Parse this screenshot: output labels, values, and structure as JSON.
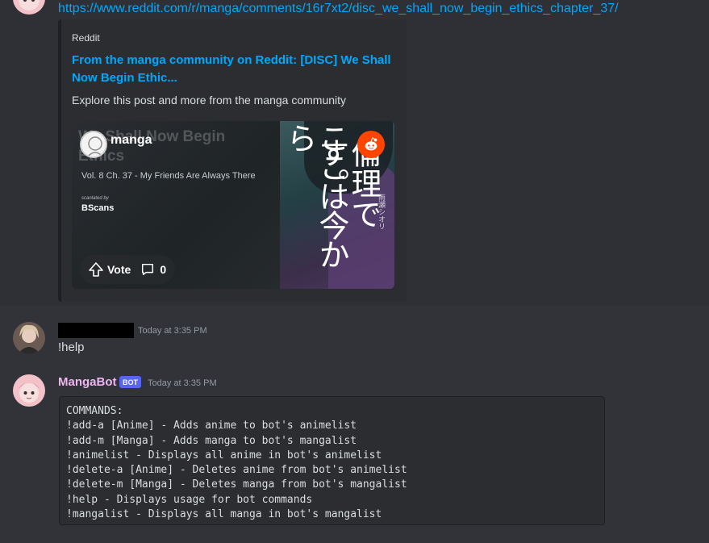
{
  "link_message": {
    "url": "https://www.reddit.com/r/manga/comments/16r7xt2/disc_we_shall_now_begin_ethics_chapter_37/"
  },
  "embed": {
    "provider": "Reddit",
    "title": "From the manga community on Reddit: [DISC] We Shall Now Begin Ethic...",
    "description": "Explore this post and more from the manga community",
    "image": {
      "background_title": "We Shall Now Begin Ethics",
      "subreddit": "manga",
      "chapter_info": "Vol. 8 Ch. 37 - My Friends Are Always There",
      "scanlated_by_label": "scanlated by",
      "scanlator": "BScans",
      "cover_text_1": "ここは今から",
      "cover_text_2": "倫理です。",
      "cover_author": "雨瀬シオリ",
      "vote_label": "Vote",
      "comment_count": "0",
      "reddit_icon": "reddit-icon"
    }
  },
  "user_message": {
    "timestamp": "Today at 3:35 PM",
    "text": "!help"
  },
  "bot_message": {
    "name": "MangaBot",
    "badge": "BOT",
    "timestamp": "Today at 3:35 PM",
    "code_lines": [
      "COMMANDS:",
      "!add-a [Anime] - Adds anime to bot's animelist",
      "!add-m [Manga] - Adds manga to bot's mangalist",
      "!animelist - Displays all anime in bot's animelist",
      "!delete-a [Anime] - Deletes anime from bot's animelist",
      "!delete-m [Manga] - Deletes manga from bot's mangalist",
      "!help - Displays usage for bot commands",
      "!mangalist - Displays all manga in bot's mangalist"
    ]
  },
  "colors": {
    "background": "#313338",
    "hover_background": "#2e3035",
    "link": "#00a8fc",
    "bot_name": "#f0b5f0",
    "bot_badge": "#5865f2",
    "reddit": "#ff4500"
  }
}
